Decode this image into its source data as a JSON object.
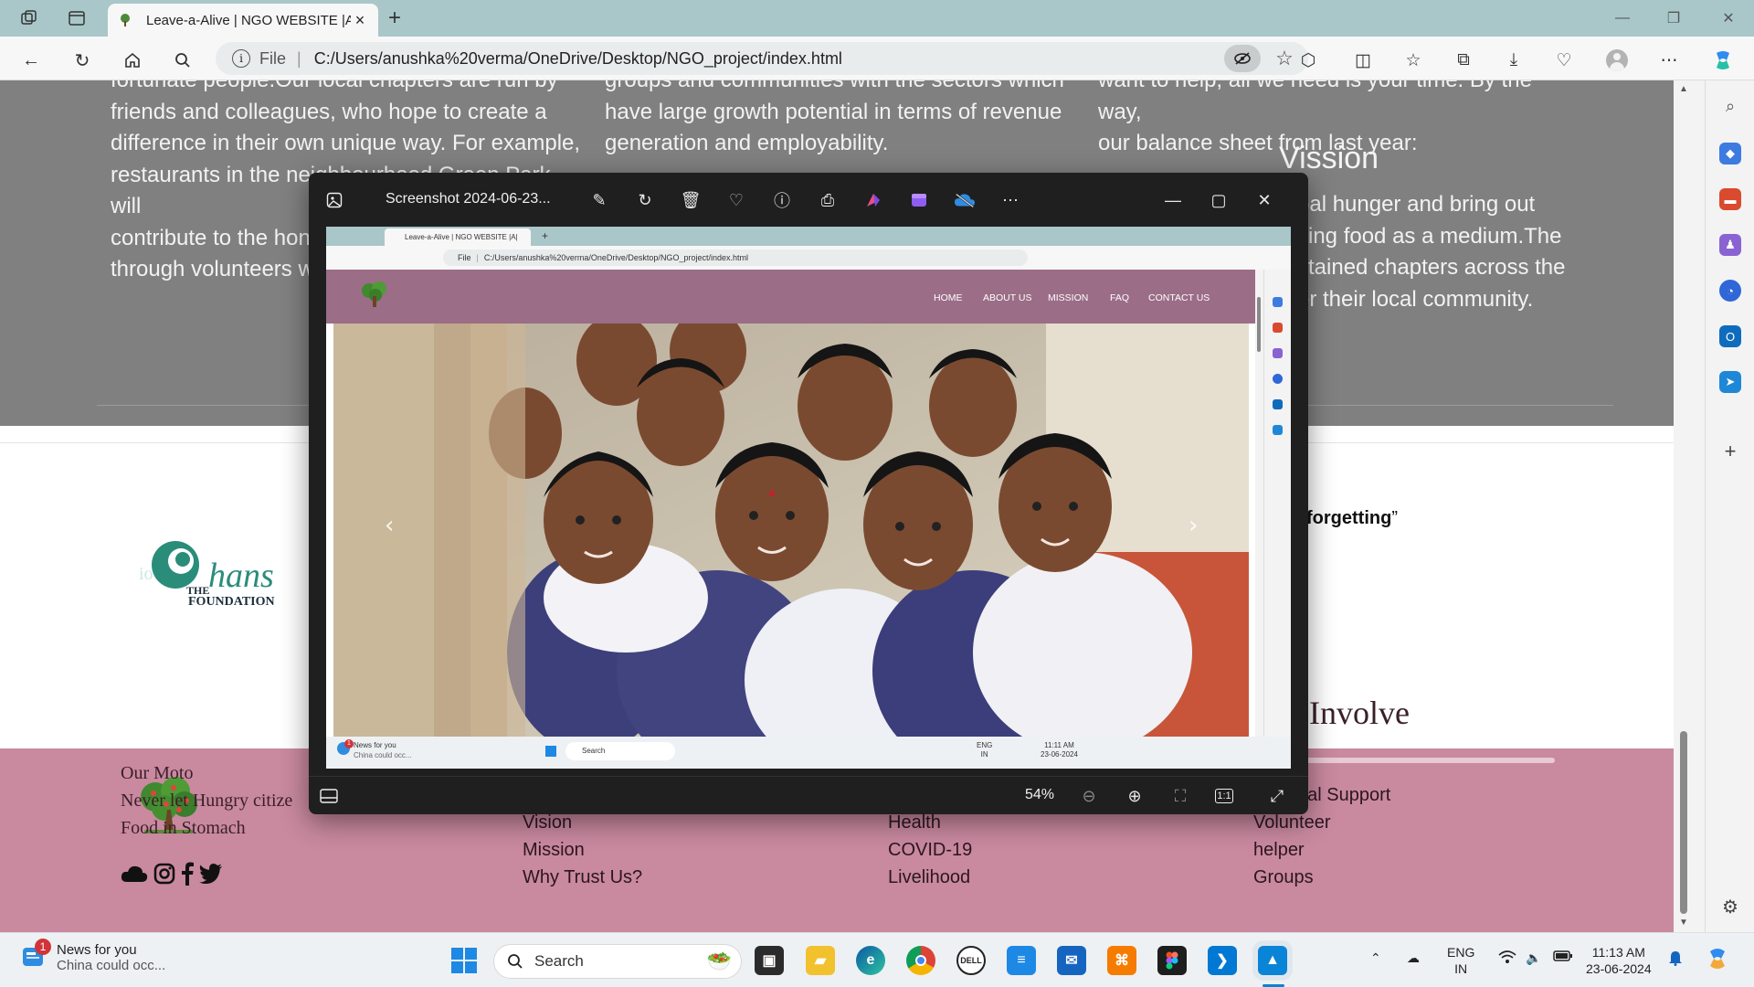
{
  "browser": {
    "tab_title": "Leave-a-Alive | NGO WEBSITE |A|",
    "url_scheme": "File",
    "url": "C:/Users/anushka%20verma/OneDrive/Desktop/NGO_project/index.html"
  },
  "page": {
    "col1": [
      "fortunate people.Our local chapters are run by",
      "friends and colleagues, who hope to create a",
      "difference in their own unique way. For example,",
      "restaurants in the neighbourhood Green Park, will",
      "contribute to the hon",
      "through volunteers w"
    ],
    "col2": [
      "groups and communities with the sectors which",
      "have large growth potential in terms of revenue",
      "generation and employability."
    ],
    "col3": [
      "want to help, all we need is your time. By the way,",
      "our balance sheet from last year:"
    ],
    "vission_heading": "Vission",
    "col4": [
      "bal hunger and bring out",
      "sing food as a medium.The",
      "stained chapters across the",
      "er their local community."
    ],
    "quote_end": "forgetting",
    "hans_logo_the": "THE",
    "hans_logo_hans": "hans",
    "hans_logo_foundation": "FOUNDATION",
    "hans_logo_prefix": "io",
    "footer": {
      "moto_title": "Our Moto",
      "moto_line1": "Never let Hungry citize",
      "moto_line2": "Food in Stomach",
      "about_links": [
        "Vision",
        "Mission",
        "Why Trust Us?"
      ],
      "work_links": [
        "Health",
        "COVID-19",
        "Livelihood"
      ],
      "involve_heading": "Involve",
      "involve_links": [
        "ual Support",
        "Volunteer",
        "helper",
        "Groups"
      ]
    }
  },
  "viewer": {
    "title": "Screenshot 2024-06-23...",
    "zoom": "54%",
    "zoom_ratio_label": "1:1",
    "inner": {
      "tab_title": "Leave-a-Alive | NGO WEBSITE |A|",
      "url_scheme": "File",
      "url": "C:/Users/anushka%20verma/OneDrive/Desktop/NGO_project/index.html",
      "menu": [
        "HOME",
        "ABOUT US",
        "MISSION",
        "FAQ",
        "CONTACT US"
      ],
      "news_title": "News for you",
      "news_sub": "China could occ...",
      "search": "Search",
      "lang1": "ENG",
      "lang2": "IN",
      "time": "11:11 AM",
      "date": "23-06-2024",
      "news_badge": "1"
    }
  },
  "taskbar": {
    "news_title": "News for you",
    "news_sub": "China could occ...",
    "news_badge": "1",
    "search": "Search",
    "lang1": "ENG",
    "lang2": "IN",
    "time": "11:13 AM",
    "date": "23-06-2024"
  },
  "colors": {
    "tabbar": "#a9c7c9",
    "dark_section": "#808080",
    "footer_pink": "#c9899f",
    "site_nav": "#9b6d86",
    "viewer_bg": "#1f1f1f"
  }
}
